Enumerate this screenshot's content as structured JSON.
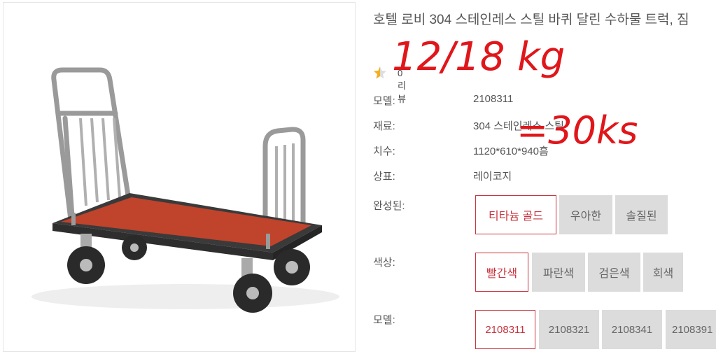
{
  "product": {
    "title": "호텔 로비 304 스테인레스 스틸 바퀴 달린 수하물 트럭, 짐",
    "rating": {
      "count_label": "0 리뷰"
    }
  },
  "specs": [
    {
      "label": "모델:",
      "value": "2108311"
    },
    {
      "label": "재료:",
      "value": "304 스테인레스 스틸"
    },
    {
      "label": "치수:",
      "value": "1120*610*940흠"
    },
    {
      "label": "상표:",
      "value": "레이코지"
    }
  ],
  "finish": {
    "label": "완성된:",
    "options": [
      "티타늄 골드",
      "우아한",
      "솔질된"
    ],
    "selected": "티타늄 골드"
  },
  "color": {
    "label": "색상:",
    "options": [
      "빨간색",
      "파란색",
      "검은색",
      "회색"
    ],
    "selected": "빨간색"
  },
  "model": {
    "label": "모델:",
    "options": [
      "2108311",
      "2108321",
      "2108341",
      "2108391"
    ],
    "selected": "2108311"
  },
  "annotations": {
    "weight_note": "12/18 kg",
    "weight_note2": "=30ks"
  },
  "colors": {
    "accent": "#c8343e",
    "option_bg": "#dcdcdc",
    "carpet": "#c0432c",
    "ink": "#e0161b"
  }
}
